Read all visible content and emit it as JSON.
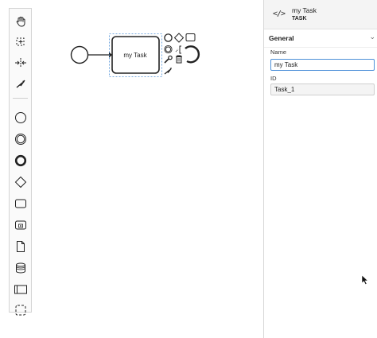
{
  "palette": {
    "tools": [
      {
        "name": "hand-tool-icon"
      },
      {
        "name": "lasso-tool-icon"
      },
      {
        "name": "space-tool-icon"
      },
      {
        "name": "global-connect-tool-icon"
      },
      {
        "name": "start-event-icon"
      },
      {
        "name": "intermediate-event-icon"
      },
      {
        "name": "end-event-icon"
      },
      {
        "name": "gateway-icon"
      },
      {
        "name": "task-icon"
      },
      {
        "name": "subprocess-icon"
      },
      {
        "name": "data-object-icon"
      },
      {
        "name": "data-store-icon"
      },
      {
        "name": "pool-icon"
      },
      {
        "name": "group-icon"
      }
    ]
  },
  "canvas": {
    "task_label": "my Task"
  },
  "properties": {
    "header": {
      "icon_text": "</>",
      "title": "my Task",
      "type": "TASK"
    },
    "group": {
      "title": "General",
      "chevron": "⌄"
    },
    "fields": {
      "name_label": "Name",
      "name_value": "my Task",
      "id_label": "ID",
      "id_value": "Task_1"
    }
  }
}
